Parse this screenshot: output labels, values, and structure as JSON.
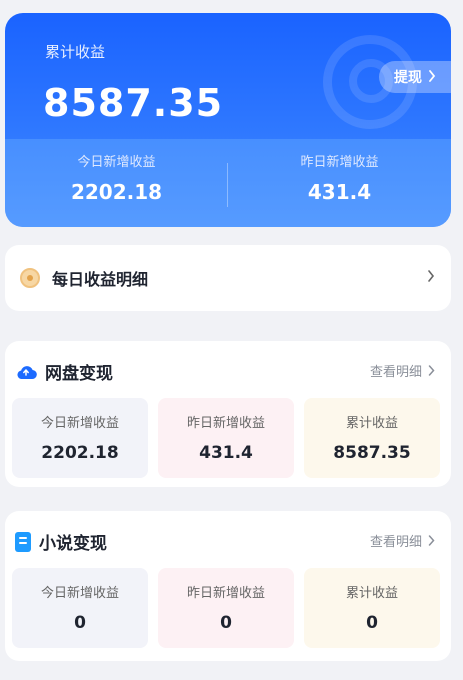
{
  "summary": {
    "label": "累计收益",
    "total": "8587.35",
    "withdraw_label": "提现",
    "today_label": "今日新增收益",
    "today_value": "2202.18",
    "yesterday_label": "昨日新增收益",
    "yesterday_value": "431.4"
  },
  "daily_detail": {
    "title": "每日收益明细"
  },
  "sections": [
    {
      "title": "网盘变现",
      "more": "查看明细",
      "icon": "cloud-icon",
      "tiles": [
        {
          "label": "今日新增收益",
          "value": "2202.18"
        },
        {
          "label": "昨日新增收益",
          "value": "431.4"
        },
        {
          "label": "累计收益",
          "value": "8587.35"
        }
      ]
    },
    {
      "title": "小说变现",
      "more": "查看明细",
      "icon": "book-icon",
      "tiles": [
        {
          "label": "今日新增收益",
          "value": "0"
        },
        {
          "label": "昨日新增收益",
          "value": "0"
        },
        {
          "label": "累计收益",
          "value": "0"
        }
      ]
    }
  ],
  "colors": {
    "primary": "#1a63ff",
    "tile_neutral": "#f2f3f9",
    "tile_pink": "#fdf1f4",
    "tile_cream": "#fdf8ec"
  }
}
